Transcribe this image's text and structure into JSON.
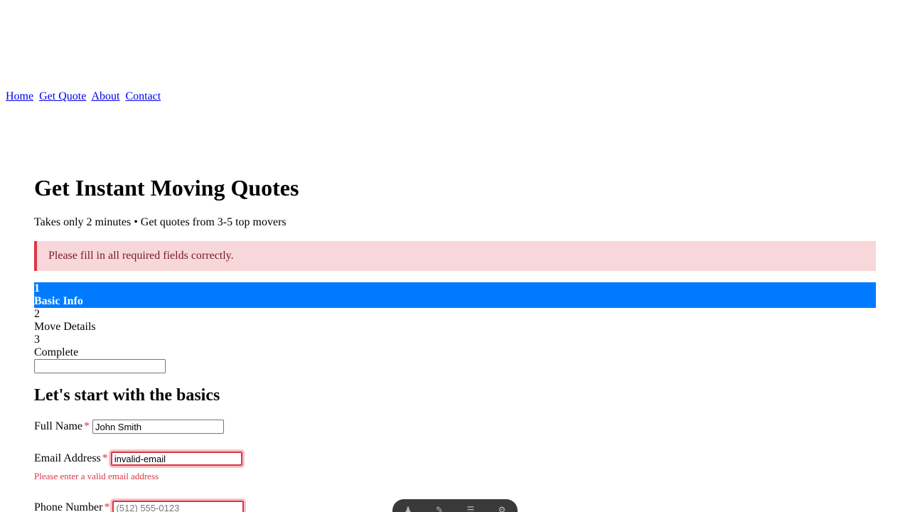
{
  "nav": {
    "links": [
      "Home",
      "Get Quote",
      "About",
      "Contact"
    ]
  },
  "hero": {
    "title": "Get Instant Moving Quotes",
    "subtitle": "Takes only 2 minutes • Get quotes from 3-5 top movers"
  },
  "alert": {
    "message": "Please fill in all required fields correctly."
  },
  "steps": [
    {
      "num": "1",
      "label": "Basic Info",
      "active": true
    },
    {
      "num": "2",
      "label": "Move Details",
      "active": false
    },
    {
      "num": "3",
      "label": "Complete",
      "active": false
    }
  ],
  "form": {
    "section_title": "Let's start with the basics",
    "required_marker": "*",
    "full_name": {
      "label": "Full Name",
      "value": "John Smith"
    },
    "email": {
      "label": "Email Address",
      "value": "invalid-email",
      "error": "Please enter a valid email address"
    },
    "phone": {
      "label": "Phone Number",
      "value": "",
      "placeholder": "(512) 555-0123"
    }
  },
  "floating_toolbar": {
    "icons": [
      "person-icon",
      "pen-icon",
      "menu-icon",
      "settings-icon"
    ]
  },
  "colors": {
    "accent": "#007bff",
    "error": "#dc3545",
    "alert_bg": "#f8d7da"
  }
}
